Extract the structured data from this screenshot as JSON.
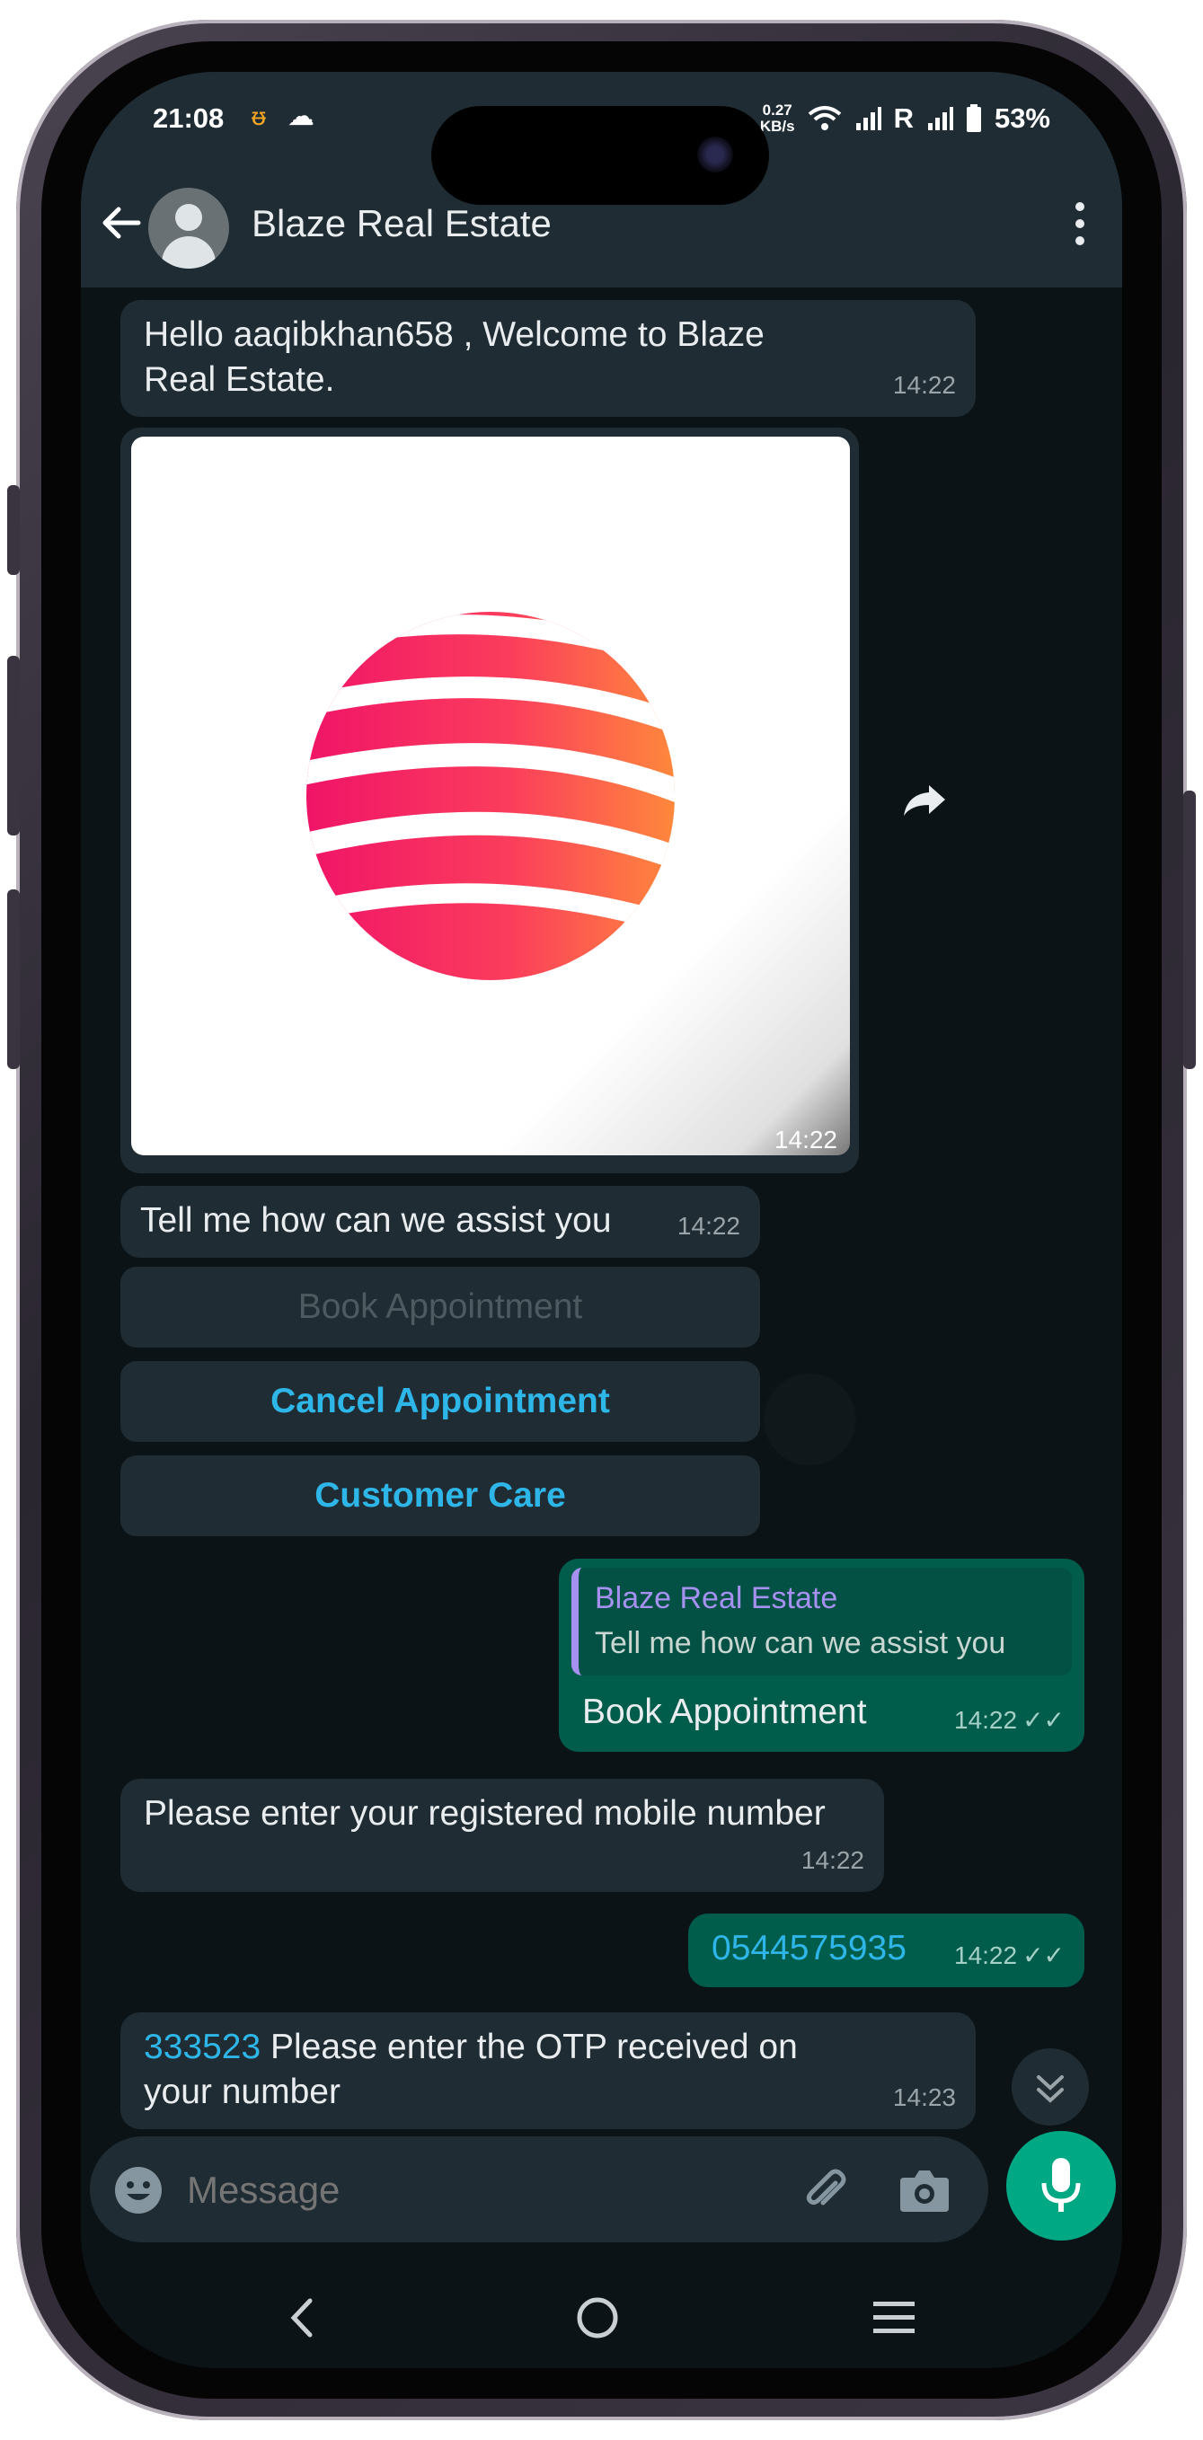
{
  "status_bar": {
    "time": "21:08",
    "net_speed_top": "0.27",
    "net_speed_bottom": "KB/s",
    "roaming": "R",
    "battery": "53%"
  },
  "header": {
    "contact_name": "Blaze Real Estate"
  },
  "messages": {
    "welcome_text": "Hello aaqibkhan658 , Welcome to Blaze Real Estate.",
    "welcome_time": "14:22",
    "image_time": "14:22",
    "assist_text": "Tell me how can we assist you",
    "assist_time": "14:22",
    "buttons": [
      "Book Appointment",
      "Cancel Appointment",
      "Customer Care"
    ],
    "reply_quote_author": "Blaze Real Estate",
    "reply_quote_text": "Tell me how can we assist you",
    "reply_text": "Book Appointment",
    "reply_time": "14:22",
    "mobile_prompt": "Please enter your registered mobile number",
    "mobile_prompt_time": "14:22",
    "mobile_number": "0544575935",
    "mobile_number_time": "14:22",
    "otp_code": "333523",
    "otp_text": " Please enter the OTP received on your number",
    "otp_time": "14:23"
  },
  "composer": {
    "placeholder": "Message"
  },
  "colors": {
    "header_bg": "#1f2c33",
    "chat_bg": "#0b1317",
    "incoming_bubble": "#1f2c33",
    "outgoing_bubble": "#005c4b",
    "link": "#2eb6e8",
    "mic_button": "#00a884"
  }
}
